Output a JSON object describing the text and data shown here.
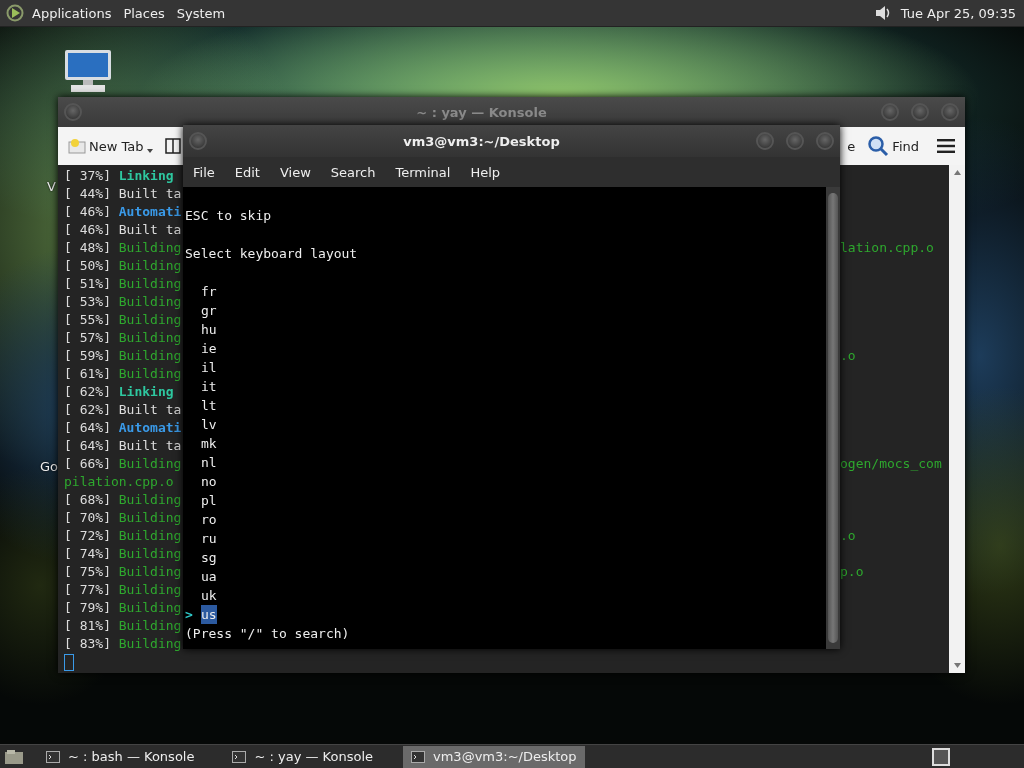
{
  "top_panel": {
    "menus": [
      "Applications",
      "Places",
      "System"
    ],
    "clock": "Tue Apr 25, 09:35"
  },
  "desktop": {
    "icon_labels": [
      "V",
      "Go"
    ]
  },
  "konsole": {
    "title": "~ : yay — Konsole",
    "active": false,
    "toolbar": {
      "new_tab": "New Tab",
      "cut_button": "e",
      "find": "Find"
    },
    "lines": [
      {
        "kind": "link",
        "pct": "[ 37%]",
        "text": "Linking"
      },
      {
        "kind": "built",
        "pct": "[ 44%]",
        "text": "Built ta"
      },
      {
        "kind": "automoc",
        "pct": "[ 46%]",
        "text": "Automati"
      },
      {
        "kind": "built",
        "pct": "[ 46%]",
        "text": "Built ta"
      },
      {
        "kind": "building",
        "pct": "[ 48%]",
        "text": "Building",
        "right": "lation.cpp.o"
      },
      {
        "kind": "building",
        "pct": "[ 50%]",
        "text": "Building"
      },
      {
        "kind": "building",
        "pct": "[ 51%]",
        "text": "Building"
      },
      {
        "kind": "building",
        "pct": "[ 53%]",
        "text": "Building"
      },
      {
        "kind": "building",
        "pct": "[ 55%]",
        "text": "Building"
      },
      {
        "kind": "building",
        "pct": "[ 57%]",
        "text": "Building"
      },
      {
        "kind": "building",
        "pct": "[ 59%]",
        "text": "Building",
        "right": ".o"
      },
      {
        "kind": "building",
        "pct": "[ 61%]",
        "text": "Building"
      },
      {
        "kind": "link",
        "pct": "[ 62%]",
        "text": "Linking"
      },
      {
        "kind": "built",
        "pct": "[ 62%]",
        "text": "Built ta"
      },
      {
        "kind": "automoc",
        "pct": "[ 64%]",
        "text": "Automati"
      },
      {
        "kind": "built",
        "pct": "[ 64%]",
        "text": "Built ta"
      },
      {
        "kind": "building",
        "pct": "[ 66%]",
        "text": "Building",
        "right": "ogen/mocs_com"
      },
      {
        "kind": "wrap",
        "text": "pilation.cpp.o"
      },
      {
        "kind": "building",
        "pct": "[ 68%]",
        "text": "Building"
      },
      {
        "kind": "building",
        "pct": "[ 70%]",
        "text": "Building"
      },
      {
        "kind": "building",
        "pct": "[ 72%]",
        "text": "Building",
        "right": ".o"
      },
      {
        "kind": "building",
        "pct": "[ 74%]",
        "text": "Building"
      },
      {
        "kind": "building",
        "pct": "[ 75%]",
        "text": "Building",
        "right": "p.o"
      },
      {
        "kind": "building",
        "pct": "[ 77%]",
        "text": "Building"
      },
      {
        "kind": "building",
        "pct": "[ 79%]",
        "text": "Building"
      },
      {
        "kind": "building",
        "pct": "[ 81%]",
        "text": "Building"
      },
      {
        "kind": "building",
        "pct": "[ 83%]",
        "text": "Building"
      }
    ]
  },
  "terminal": {
    "title": "vm3@vm3:~/Desktop",
    "active": true,
    "menus": [
      "File",
      "Edit",
      "View",
      "Search",
      "Terminal",
      "Help"
    ],
    "hint": "ESC to skip",
    "prompt": "Select keyboard layout",
    "pointer": ">",
    "options": [
      {
        "label": "fr",
        "selected": false
      },
      {
        "label": "gr",
        "selected": false
      },
      {
        "label": "hu",
        "selected": false
      },
      {
        "label": "ie",
        "selected": false
      },
      {
        "label": "il",
        "selected": false
      },
      {
        "label": "it",
        "selected": false
      },
      {
        "label": "lt",
        "selected": false
      },
      {
        "label": "lv",
        "selected": false
      },
      {
        "label": "mk",
        "selected": false
      },
      {
        "label": "nl",
        "selected": false
      },
      {
        "label": "no",
        "selected": false
      },
      {
        "label": "pl",
        "selected": false
      },
      {
        "label": "ro",
        "selected": false
      },
      {
        "label": "ru",
        "selected": false
      },
      {
        "label": "sg",
        "selected": false
      },
      {
        "label": "ua",
        "selected": false
      },
      {
        "label": "uk",
        "selected": false
      },
      {
        "label": "us",
        "selected": true
      }
    ],
    "footer": "(Press \"/\" to search)"
  },
  "taskbar": {
    "tasks": [
      {
        "label": "~ : bash — Konsole",
        "selected": false
      },
      {
        "label": "~ : yay — Konsole",
        "selected": false
      },
      {
        "label": "vm3@vm3:~/Desktop",
        "selected": true
      }
    ]
  }
}
